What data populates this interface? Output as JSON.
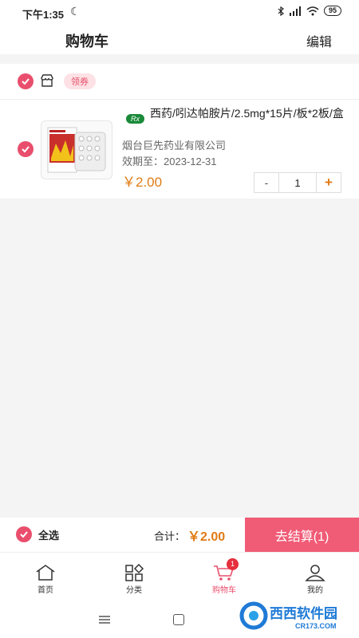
{
  "status": {
    "time": "下午1:35",
    "battery": "95"
  },
  "nav": {
    "title": "购物车",
    "edit": "编辑"
  },
  "store": {
    "coupon": "领券"
  },
  "item": {
    "rx": "Rx",
    "name": "西药/吲达帕胺片/2.5mg*15片/板*2板/盒",
    "company": "烟台巨先药业有限公司",
    "expiry": "效期至：2023-12-31",
    "price": "￥2.00",
    "qty": "1",
    "minus": "-",
    "plus": "+",
    "thumb_text": "吲达帕胺片"
  },
  "checkout": {
    "select_all": "全选",
    "total_label": "合计：",
    "total": "￥2.00",
    "button": "去结算(1)"
  },
  "tabs": [
    {
      "label": "首页",
      "icon": "home-icon"
    },
    {
      "label": "分类",
      "icon": "category-icon"
    },
    {
      "label": "购物车",
      "icon": "cart-icon",
      "badge": "1",
      "active": true
    },
    {
      "label": "我的",
      "icon": "profile-icon"
    }
  ],
  "watermark": {
    "brand": "西西软件园",
    "site": "CR173.COM"
  },
  "colors": {
    "accent": "#e94f6d",
    "price": "#e07b14",
    "checkout": "#f05b76",
    "rx": "#1a8a3a"
  }
}
